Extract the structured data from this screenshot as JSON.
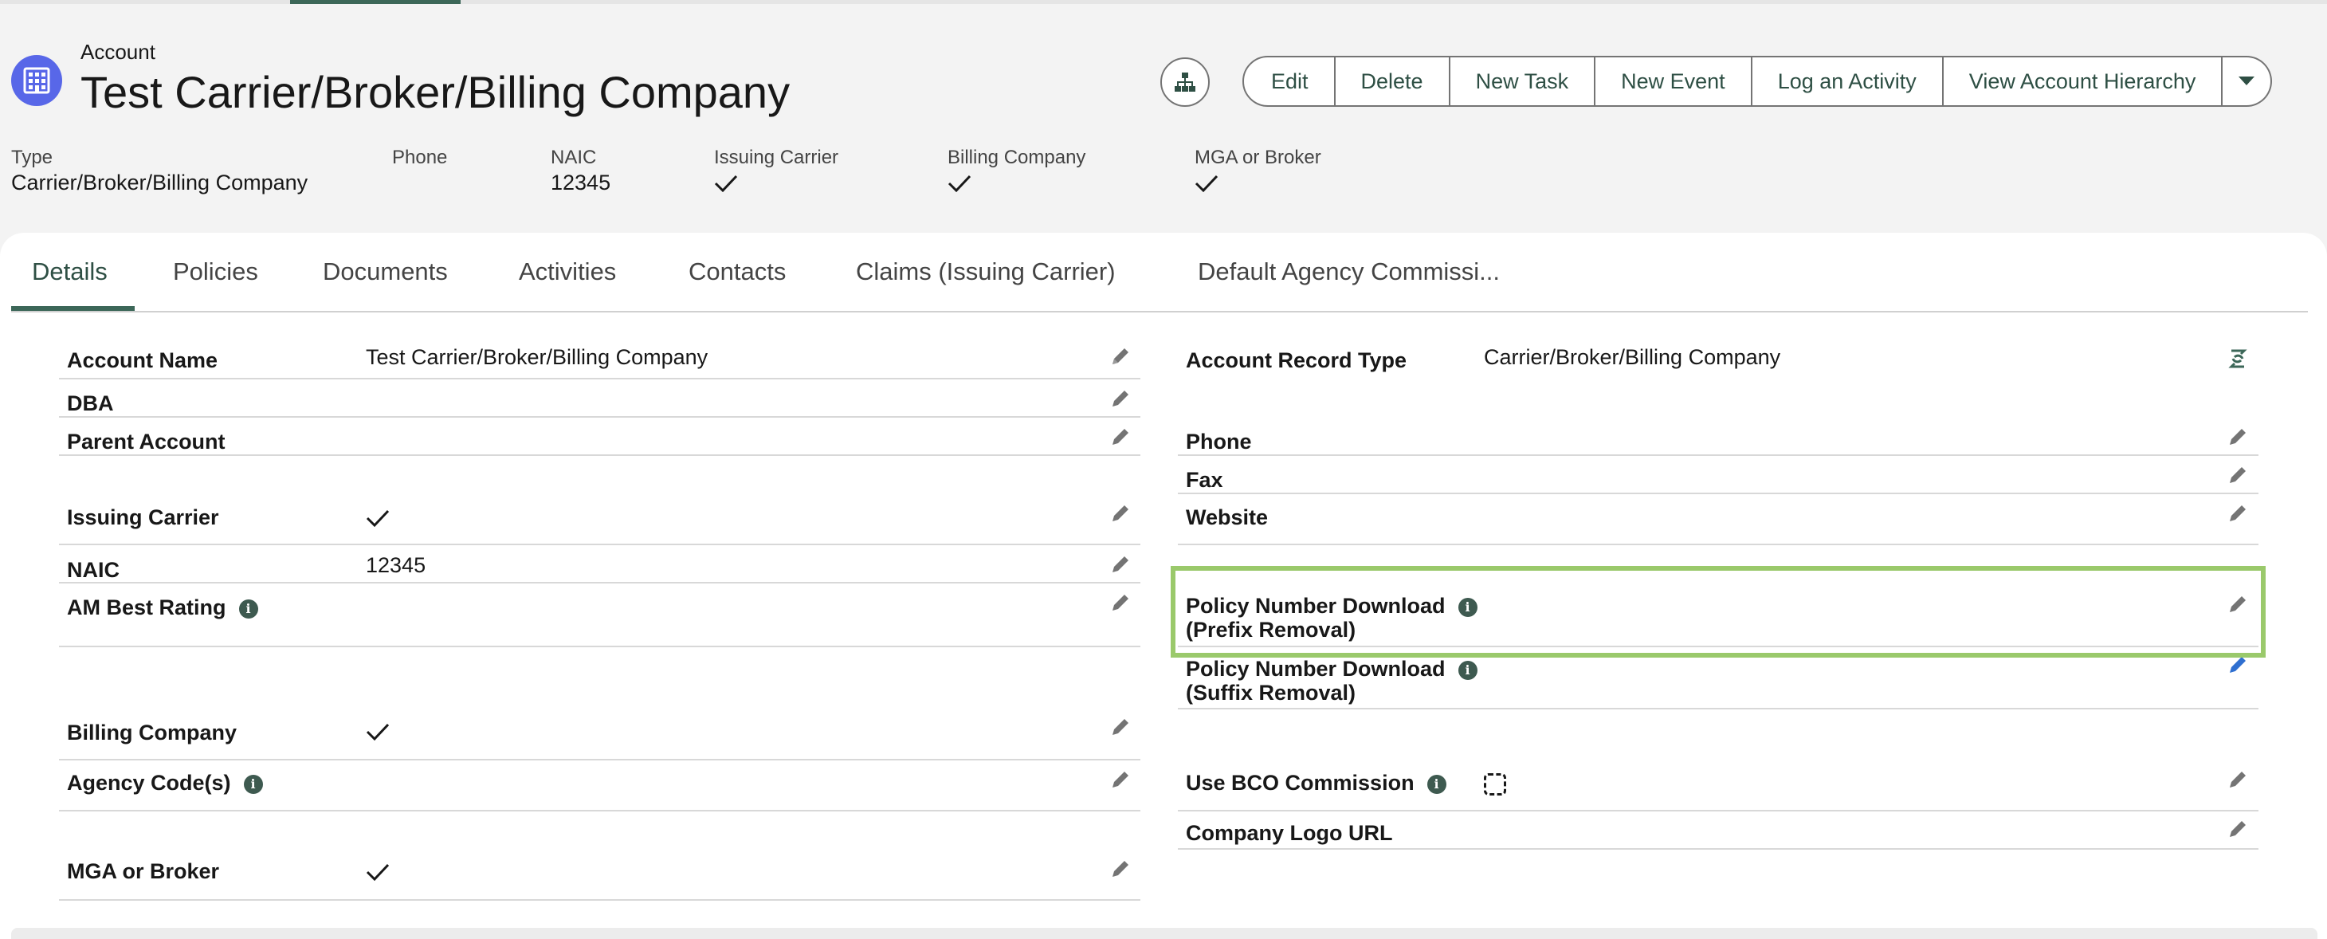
{
  "header": {
    "object_label": "Account",
    "title": "Test Carrier/Broker/Billing Company",
    "actions": [
      "Edit",
      "Delete",
      "New Task",
      "New Event",
      "Log an Activity",
      "View Account Hierarchy"
    ]
  },
  "highlights": [
    {
      "label": "Type",
      "value": "Carrier/Broker/Billing Company"
    },
    {
      "label": "Phone",
      "value": ""
    },
    {
      "label": "NAIC",
      "value": "12345"
    },
    {
      "label": "Issuing Carrier",
      "value": "checked"
    },
    {
      "label": "Billing Company",
      "value": "checked"
    },
    {
      "label": "MGA or Broker",
      "value": "checked"
    }
  ],
  "tabs": [
    "Details",
    "Policies",
    "Documents",
    "Activities",
    "Contacts",
    "Claims (Issuing Carrier)",
    "Default Agency Commissi..."
  ],
  "left_fields": [
    {
      "label": "Account Name",
      "value": "Test Carrier/Broker/Billing Company"
    },
    {
      "label": "DBA",
      "value": ""
    },
    {
      "label": "Parent Account",
      "value": ""
    },
    {
      "label": "Issuing Carrier",
      "value": "checked"
    },
    {
      "label": "NAIC",
      "value": "12345"
    },
    {
      "label": "AM Best Rating",
      "value": ""
    },
    {
      "label": "Billing Company",
      "value": "checked"
    },
    {
      "label": "Agency Code(s)",
      "value": ""
    },
    {
      "label": "MGA or Broker",
      "value": "checked"
    }
  ],
  "right_fields": [
    {
      "label": "Account Record Type",
      "value": "Carrier/Broker/Billing Company"
    },
    {
      "label": "Phone",
      "value": ""
    },
    {
      "label": "Fax",
      "value": ""
    },
    {
      "label": "Website",
      "value": ""
    },
    {
      "label": "Policy Number Download",
      "label2": "(Prefix Removal)",
      "value": ""
    },
    {
      "label": "Policy Number Download",
      "label2": "(Suffix Removal)",
      "value": ""
    },
    {
      "label": "Use BCO Commission",
      "value": "unchecked"
    },
    {
      "label": "Company Logo URL",
      "value": ""
    }
  ],
  "colors": {
    "brand": "#3c6758",
    "account_icon": "#5867e8",
    "highlight_box": "#9ac96b",
    "info_icon": "#3e5a50"
  },
  "icons": [
    "building-icon",
    "hierarchy-icon",
    "chevron-down-icon",
    "pencil-icon",
    "change-record-type-icon",
    "info-icon",
    "checkmark-icon"
  ]
}
